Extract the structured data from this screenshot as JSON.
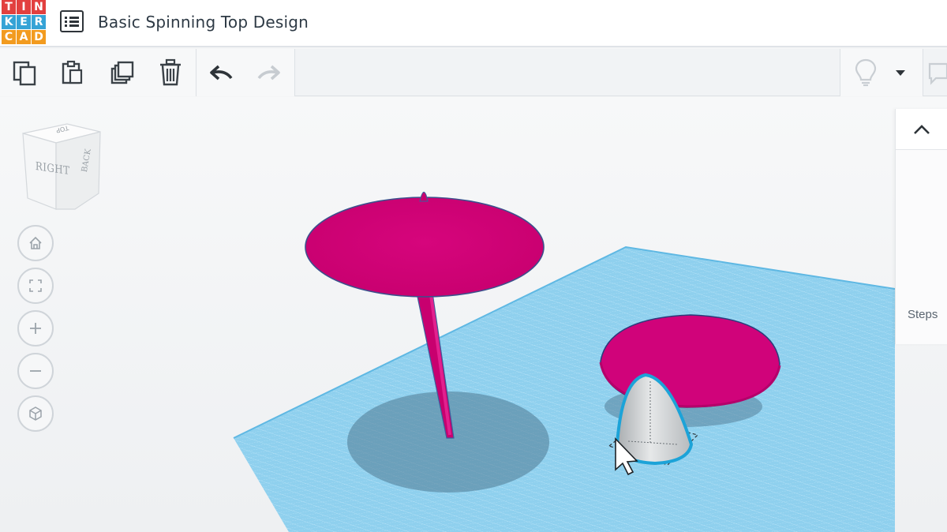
{
  "app": {
    "logo_letters": [
      "T",
      "I",
      "N",
      "K",
      "E",
      "R",
      "C",
      "A",
      "D"
    ],
    "logo_colors": [
      "#e2403f",
      "#e2403f",
      "#e2403f",
      "#35a3d6",
      "#35a3d6",
      "#35a3d6",
      "#f29b1f",
      "#f29b1f",
      "#f29b1f"
    ],
    "design_title": "Basic Spinning Top Design"
  },
  "toolbar": {
    "items": [
      {
        "name": "copy-button",
        "icon": "copy-icon"
      },
      {
        "name": "paste-button",
        "icon": "paste-icon"
      },
      {
        "name": "duplicate-button",
        "icon": "duplicate-icon"
      },
      {
        "name": "delete-button",
        "icon": "trash-icon"
      },
      {
        "name": "undo-button",
        "icon": "undo-icon"
      },
      {
        "name": "redo-button",
        "icon": "redo-icon",
        "disabled": true
      },
      {
        "name": "light-bulb-button",
        "icon": "lightbulb-icon"
      },
      {
        "name": "bulb-dropdown-button",
        "icon": "caret-down-icon"
      },
      {
        "name": "notes-button",
        "icon": "comment-icon"
      }
    ]
  },
  "viewcube": {
    "faces": {
      "right": "RIGHT",
      "back": "BACK",
      "top": "TOP"
    }
  },
  "nav_controls": [
    {
      "name": "home-view-button",
      "icon": "home-icon"
    },
    {
      "name": "fit-view-button",
      "icon": "fit-icon"
    },
    {
      "name": "zoom-in-button",
      "icon": "plus-icon"
    },
    {
      "name": "zoom-out-button",
      "icon": "minus-icon"
    },
    {
      "name": "ortho-view-button",
      "icon": "cube-icon"
    }
  ],
  "right_panel": {
    "steps_label": "Steps"
  },
  "colors": {
    "shape_magenta": "#d6057c",
    "workplane_blue": "#8fd0ee",
    "selection_outline": "#1ca3d8"
  }
}
